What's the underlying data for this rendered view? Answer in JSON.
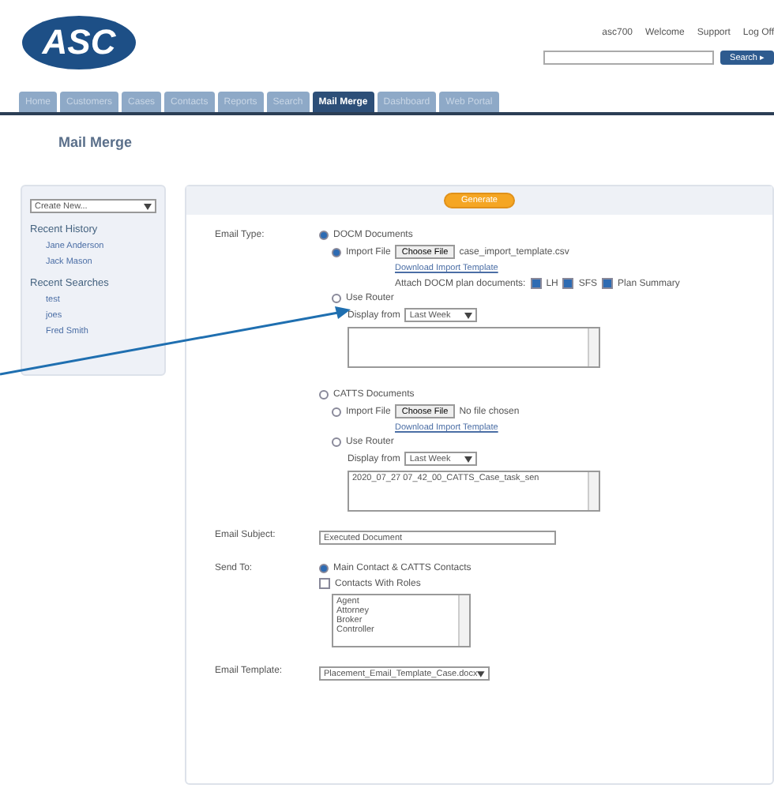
{
  "header": {
    "logo": "ASC",
    "user_links": [
      "asc700",
      "Welcome",
      "Support",
      "Log Off"
    ],
    "search_button": "Search ▸"
  },
  "tabs": [
    {
      "label": "Home",
      "selected": false
    },
    {
      "label": "Customers",
      "selected": false
    },
    {
      "label": "Cases",
      "selected": false
    },
    {
      "label": "Contacts",
      "selected": false
    },
    {
      "label": "Reports",
      "selected": false
    },
    {
      "label": "Search",
      "selected": false
    },
    {
      "label": "Mail Merge",
      "selected": true
    },
    {
      "label": "Dashboard",
      "selected": false
    },
    {
      "label": "Web Portal",
      "selected": false
    }
  ],
  "page_title": "Mail Merge",
  "sidebar": {
    "create_select": "Create New...",
    "sections": [
      {
        "title": "Recent History",
        "items": [
          "Jane Anderson",
          "Jack Mason"
        ]
      },
      {
        "title": "Recent Searches",
        "items": [
          "test",
          "joes",
          "Fred Smith"
        ]
      }
    ]
  },
  "form": {
    "action_button": "Generate",
    "email_type": {
      "label": "Email Type:",
      "options": [
        {
          "label": "DOCM Documents",
          "selected": true,
          "import": {
            "label": "Import File",
            "selected": true,
            "choose_button": "Choose File",
            "file_name": "case_import_template.csv",
            "template_link": "Download Import Template",
            "attach": {
              "label": "Attach DOCM plan documents:",
              "items": [
                {
                  "label": "LH",
                  "checked": true
                },
                {
                  "label": "SFS",
                  "checked": true
                },
                {
                  "label": "Plan Summary",
                  "checked": true
                }
              ]
            }
          },
          "router": {
            "label": "Use Router",
            "selected": false,
            "display_label": "Display from",
            "display_value": "Last Week"
          }
        },
        {
          "label": "CATTS Documents",
          "selected": false,
          "import": {
            "label": "Import File",
            "selected": false,
            "choose_button": "Choose File",
            "file_name": "No file chosen",
            "template_link": "Download Import Template"
          },
          "router": {
            "label": "Use Router",
            "selected": false,
            "display_label": "Display from",
            "display_value": "Last Week",
            "list_items": [
              "2020_07_27 07_42_00_CATTS_Case_task_sen"
            ]
          }
        }
      ]
    },
    "subject": {
      "label": "Email Subject:",
      "value": "Executed Document"
    },
    "send_to": {
      "label": "Send To:",
      "main": {
        "label": "Main Contact & CATTS Contacts",
        "selected": true
      },
      "roles": {
        "label": "Contacts With Roles",
        "checked": false,
        "items": [
          "Agent",
          "Attorney",
          "Broker",
          "Controller"
        ]
      }
    },
    "template": {
      "label": "Email Template:",
      "value": "Placement_Email_Template_Case.docx"
    }
  }
}
